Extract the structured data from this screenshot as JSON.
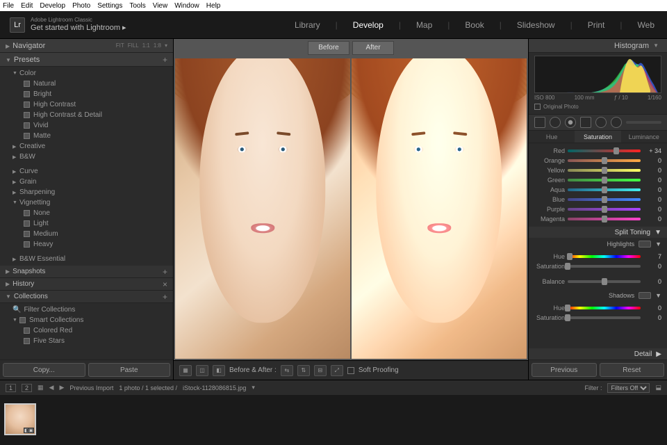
{
  "menubar": [
    "File",
    "Edit",
    "Develop",
    "Photo",
    "Settings",
    "Tools",
    "View",
    "Window",
    "Help"
  ],
  "brand": {
    "logo": "Lr",
    "line1": "Adobe Lightroom Classic",
    "line2": "Get started with Lightroom ▸"
  },
  "modules": {
    "items": [
      "Library",
      "Develop",
      "Map",
      "Book",
      "Slideshow",
      "Print",
      "Web"
    ],
    "active": "Develop"
  },
  "leftPanels": {
    "navigator": {
      "title": "Navigator",
      "fit": "FIT",
      "fill": "FILL",
      "ratio": "1:1",
      "zoom": "1:8"
    },
    "presets": {
      "title": "Presets",
      "groups": [
        {
          "label": "Color",
          "expanded": true,
          "items": [
            "Natural",
            "Bright",
            "High Contrast",
            "High Contrast & Detail",
            "Vivid",
            "Matte"
          ]
        },
        {
          "label": "Creative",
          "expanded": false
        },
        {
          "label": "B&W",
          "expanded": false
        },
        {
          "label": "Curve",
          "expanded": false
        },
        {
          "label": "Grain",
          "expanded": false
        },
        {
          "label": "Sharpening",
          "expanded": false
        },
        {
          "label": "Vignetting",
          "expanded": true,
          "items": [
            "None",
            "Light",
            "Medium",
            "Heavy"
          ]
        },
        {
          "label": "B&W Essential",
          "expanded": false
        }
      ]
    },
    "snapshots": {
      "title": "Snapshots"
    },
    "history": {
      "title": "History"
    },
    "collections": {
      "title": "Collections",
      "filter": "Filter Collections",
      "smart": "Smart Collections",
      "items": [
        "Colored Red",
        "Five Stars"
      ]
    },
    "buttons": {
      "copy": "Copy...",
      "paste": "Paste"
    }
  },
  "center": {
    "before": "Before",
    "after": "After",
    "toolbar": {
      "label": "Before & After :",
      "soft": "Soft Proofing"
    }
  },
  "right": {
    "histogram": {
      "title": "Histogram",
      "meta": {
        "iso": "ISO 800",
        "focal": "100 mm",
        "aperture": "ƒ / 10",
        "shutter": "1/160"
      },
      "original": "Original Photo"
    },
    "hsl": {
      "tabs": [
        "Hue",
        "Saturation",
        "Luminance"
      ],
      "active": "Saturation",
      "rows": [
        {
          "name": "Red",
          "val": "+ 34",
          "pos": 67,
          "cls": "red"
        },
        {
          "name": "Orange",
          "val": "0",
          "pos": 50,
          "cls": "orange"
        },
        {
          "name": "Yellow",
          "val": "0",
          "pos": 50,
          "cls": "yellow"
        },
        {
          "name": "Green",
          "val": "0",
          "pos": 50,
          "cls": "green"
        },
        {
          "name": "Aqua",
          "val": "0",
          "pos": 50,
          "cls": "aqua"
        },
        {
          "name": "Blue",
          "val": "0",
          "pos": 50,
          "cls": "blue"
        },
        {
          "name": "Purple",
          "val": "0",
          "pos": 50,
          "cls": "purple"
        },
        {
          "name": "Magenta",
          "val": "0",
          "pos": 50,
          "cls": "magenta"
        }
      ]
    },
    "splitToning": {
      "title": "Split Toning",
      "highlights": {
        "label": "Highlights",
        "hue": {
          "name": "Hue",
          "val": "7",
          "pos": 3,
          "cls": "hue"
        },
        "sat": {
          "name": "Saturation",
          "val": "0",
          "pos": 0,
          "cls": "gray"
        }
      },
      "balance": {
        "name": "Balance",
        "val": "0",
        "pos": 50,
        "cls": "gray"
      },
      "shadows": {
        "label": "Shadows",
        "hue": {
          "name": "Hue",
          "val": "0",
          "pos": 0,
          "cls": "hue"
        },
        "sat": {
          "name": "Saturation",
          "val": "0",
          "pos": 0,
          "cls": "gray"
        }
      }
    },
    "detail": {
      "title": "Detail"
    },
    "buttons": {
      "prev": "Previous",
      "reset": "Reset"
    }
  },
  "filmstrip": {
    "nav": [
      "1",
      "2"
    ],
    "source": "Previous Import",
    "count": "1 photo / 1 selected /",
    "file": "iStock-1128086815.jpg",
    "filterLabel": "Filter :",
    "filterValue": "Filters Off"
  }
}
